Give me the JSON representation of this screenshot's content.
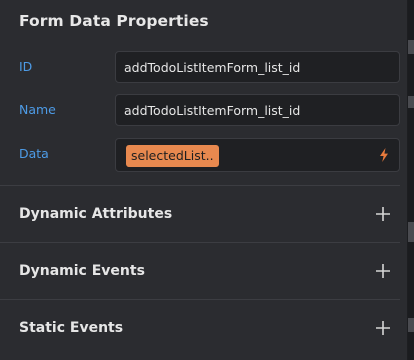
{
  "panel": {
    "title": "Form Data Properties"
  },
  "properties": [
    {
      "label": "ID",
      "value": "addTodoListItemForm_list_id"
    },
    {
      "label": "Name",
      "value": "addTodoListItemForm_list_id"
    }
  ],
  "data_field": {
    "label": "Data",
    "chip": "selectedList..",
    "icon": "lightning-bolt-icon"
  },
  "sections": [
    {
      "title": "Dynamic Attributes",
      "icon": "plus-icon"
    },
    {
      "title": "Dynamic Events",
      "icon": "plus-icon"
    },
    {
      "title": "Static Events",
      "icon": "plus-icon"
    }
  ],
  "colors": {
    "background": "#2b2c30",
    "field_background": "#1f2023",
    "label_blue": "#4d9be6",
    "chip_orange": "#e8894f",
    "bolt_orange": "#e87a3c"
  }
}
